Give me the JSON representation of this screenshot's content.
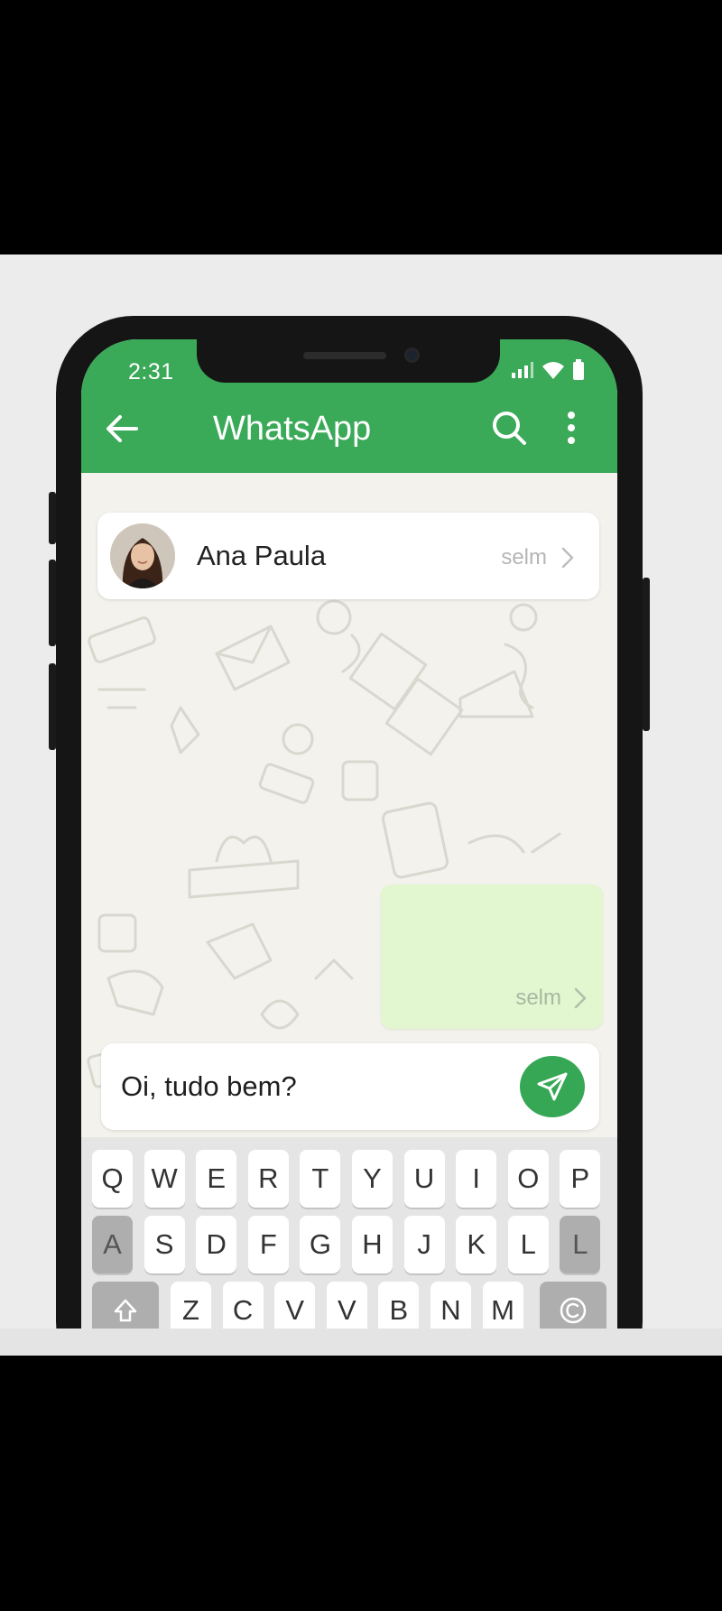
{
  "status_bar": {
    "time": "2:31",
    "icons": [
      "signal-icon",
      "wifi-icon",
      "battery-icon"
    ]
  },
  "header": {
    "back_icon": "arrow-left-icon",
    "title": "WhatsApp",
    "search_icon": "search-icon",
    "menu_icon": "more-vertical-icon"
  },
  "contact": {
    "name": "Ana Paula",
    "meta": "selm",
    "chevron_icon": "chevron-right-icon"
  },
  "message_bubble": {
    "text": "",
    "meta": "selm",
    "chevron_icon": "chevron-right-icon"
  },
  "composer": {
    "value": "Oi, tudo bem?",
    "send_icon": "send-icon"
  },
  "keyboard": {
    "row1": [
      "Q",
      "W",
      "E",
      "R",
      "T",
      "Y",
      "U",
      "I",
      "O",
      "P"
    ],
    "row2": [
      "A",
      "S",
      "D",
      "F",
      "G",
      "H",
      "J",
      "K",
      "L",
      "L"
    ],
    "row3": [
      "Z",
      "C",
      "V",
      "V",
      "B",
      "N",
      "M"
    ],
    "shift_icon": "shift-icon",
    "delete_icon": "backspace-icon"
  },
  "colors": {
    "header_green": "#3aa958",
    "send_green": "#35a755",
    "bubble_green": "#e2f7cf",
    "wallpaper": "#f3f2ec"
  }
}
